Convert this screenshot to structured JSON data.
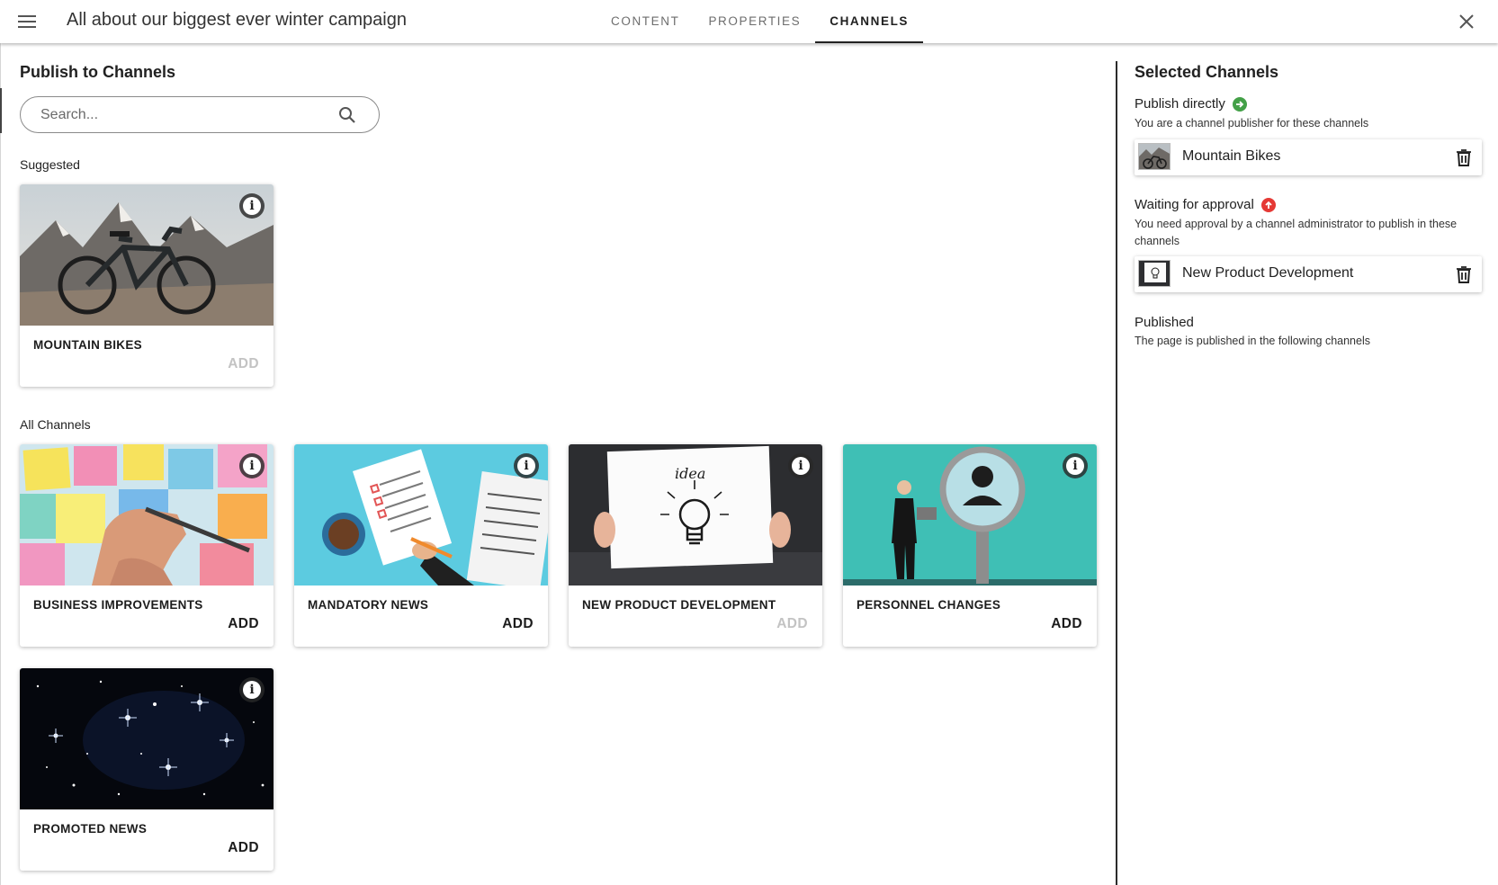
{
  "header": {
    "title": "All about our biggest ever winter campaign",
    "tabs": [
      {
        "label": "CONTENT",
        "active": false
      },
      {
        "label": "PROPERTIES",
        "active": false
      },
      {
        "label": "CHANNELS",
        "active": true
      }
    ]
  },
  "publish": {
    "title": "Publish to Channels",
    "search_placeholder": "Search...",
    "suggested_label": "Suggested",
    "all_channels_label": "All Channels",
    "suggested": [
      {
        "name": "MOUNTAIN BIKES",
        "add_label": "ADD",
        "add_enabled": false,
        "image": "mountain-bike"
      }
    ],
    "channels": [
      {
        "name": "BUSINESS IMPROVEMENTS",
        "add_label": "ADD",
        "add_enabled": true,
        "image": "sticky-notes"
      },
      {
        "name": "MANDATORY NEWS",
        "add_label": "ADD",
        "add_enabled": true,
        "image": "checklist-news"
      },
      {
        "name": "NEW PRODUCT DEVELOPMENT",
        "add_label": "ADD",
        "add_enabled": false,
        "image": "idea-bulb"
      },
      {
        "name": "PERSONNEL CHANGES",
        "add_label": "ADD",
        "add_enabled": true,
        "image": "person-magnifier"
      },
      {
        "name": "PROMOTED NEWS",
        "add_label": "ADD",
        "add_enabled": true,
        "image": "starfield"
      }
    ]
  },
  "selected": {
    "title": "Selected Channels",
    "direct": {
      "heading": "Publish directly",
      "status_color": "#43a047",
      "description": "You are a channel publisher for these channels",
      "items": [
        {
          "name": "Mountain Bikes",
          "image": "mountain-bike"
        }
      ]
    },
    "approval": {
      "heading": "Waiting for approval",
      "status_color": "#e53935",
      "description": "You need approval by a channel administrator to publish in these channels",
      "items": [
        {
          "name": "New Product Development",
          "image": "idea-bulb"
        }
      ]
    },
    "published": {
      "heading": "Published",
      "description": "The page is published in the following channels"
    }
  }
}
